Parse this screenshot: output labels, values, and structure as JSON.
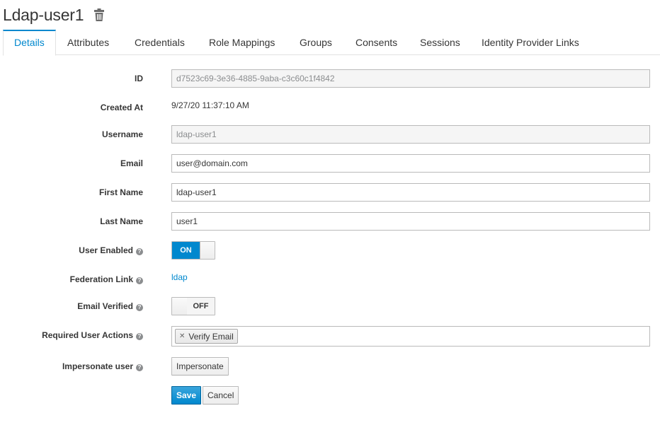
{
  "page": {
    "title": "Ldap-user1",
    "delete_icon": "trash-icon"
  },
  "tabs": [
    {
      "label": "Details",
      "active": true
    },
    {
      "label": "Attributes"
    },
    {
      "label": "Credentials"
    },
    {
      "label": "Role Mappings"
    },
    {
      "label": "Groups"
    },
    {
      "label": "Consents"
    },
    {
      "label": "Sessions"
    },
    {
      "label": "Identity Provider Links"
    }
  ],
  "form": {
    "id": {
      "label": "ID",
      "value": "d7523c69-3e36-4885-9aba-c3c60c1f4842"
    },
    "created_at": {
      "label": "Created At",
      "value": "9/27/20 11:37:10 AM"
    },
    "username": {
      "label": "Username",
      "value": "ldap-user1"
    },
    "email": {
      "label": "Email",
      "value": "user@domain.com"
    },
    "first_name": {
      "label": "First Name",
      "value": "ldap-user1"
    },
    "last_name": {
      "label": "Last Name",
      "value": "user1"
    },
    "user_enabled": {
      "label": "User Enabled",
      "state": "ON"
    },
    "federation_link": {
      "label": "Federation Link",
      "value": "ldap"
    },
    "email_verified": {
      "label": "Email Verified",
      "state": "OFF"
    },
    "required_actions": {
      "label": "Required User Actions",
      "chips": [
        "Verify Email"
      ]
    },
    "impersonate": {
      "label": "Impersonate user",
      "button": "Impersonate"
    }
  },
  "actions": {
    "save": "Save",
    "cancel": "Cancel"
  },
  "colors": {
    "accent": "#0088ce",
    "text": "#363636",
    "readonly_bg": "#f5f5f5"
  }
}
